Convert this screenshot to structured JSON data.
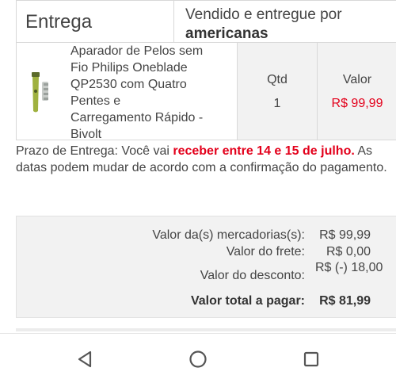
{
  "header": {
    "entrega_label": "Entrega",
    "sold_by_prefix": "Vendido e entregue por",
    "seller_name": "americanas"
  },
  "product": {
    "name_lines": [
      "Aparador de Pelos sem",
      "Fio Philips Oneblade",
      "QP2530 com Quatro",
      "Pentes e",
      "Carregamento Rápido -",
      "Bivolt"
    ],
    "qty_label": "Qtd",
    "qty": "1",
    "value_label": "Valor",
    "value": "R$ 99,99",
    "thumbnail_icon": "trimmer-product-image"
  },
  "delivery": {
    "prefix": "Prazo de Entrega: Você vai ",
    "highlight": "receber entre 14 e 15 de julho.",
    "suffix": " As datas podem mudar de acordo com a confirmação do pagamento."
  },
  "summary": {
    "merchandise_label": "Valor da(s) mercadorias(s):",
    "merchandise_value": "R$ 99,99",
    "shipping_label": "Valor do frete:",
    "shipping_value": "R$ 0,00",
    "discount_label": "Valor do desconto:",
    "discount_value": "R$ (-) 18,00",
    "total_label": "Valor total a pagar:",
    "total_value": "R$ 81,99"
  },
  "nav": {
    "back_icon": "triangle-back-icon",
    "home_icon": "circle-home-icon",
    "recents_icon": "square-recents-icon"
  },
  "colors": {
    "accent_red": "#e3001b",
    "panel_gray": "#f2f2f2",
    "text": "#444444"
  }
}
